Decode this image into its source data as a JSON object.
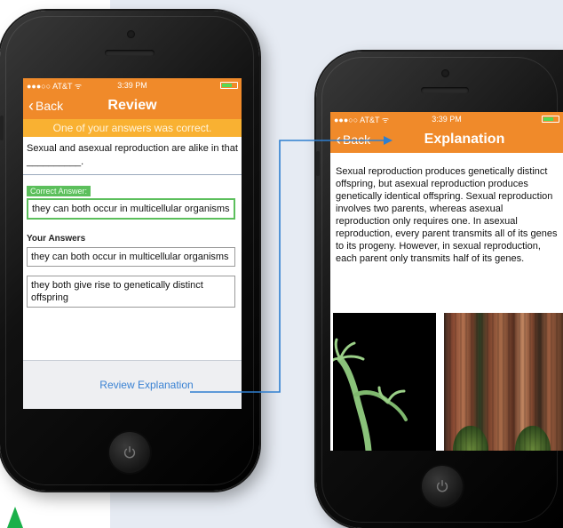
{
  "left_screen": {
    "status": {
      "carrier": "●●●○○ AT&T ᯤ",
      "time": "3:39 PM"
    },
    "nav": {
      "back_label": "Back",
      "title": "Review"
    },
    "banner": "One of your answers was correct.",
    "question": "Sexual and asexual reproduction are alike in that __________.",
    "correct_label": "Correct Answer:",
    "correct_answer": "they can both occur in multicellular organisms",
    "your_answers_label": "Your Answers",
    "answers": [
      "they can both occur in multicellular organisms",
      "they both give rise to genetically distinct offspring"
    ],
    "review_link": "Review Explanation"
  },
  "right_screen": {
    "status": {
      "carrier": "●●●○○ AT&T ᯤ",
      "time": "3:39 PM"
    },
    "nav": {
      "back_label": "Back",
      "title": "Explanation"
    },
    "explanation": "Sexual reproduction produces genetically distinct offspring, but asexual reproduction produces genetically identical offspring. Sexual reproduction involves two parents, whereas asexual reproduction only requires one. In asexual reproduction, every parent transmits all of its genes to its progeny. However, in sexual reproduction, each parent only transmits half of its genes."
  },
  "colors": {
    "nav_orange": "#f08a2a",
    "banner_yellow": "#f9b132",
    "correct_green": "#5cbf5c",
    "link_blue": "#3a82d3",
    "connector_blue": "#2f7fd0"
  },
  "icons": [
    "back-chevron-icon",
    "wifi-icon",
    "battery-icon",
    "power-icon",
    "arrow-icon"
  ]
}
